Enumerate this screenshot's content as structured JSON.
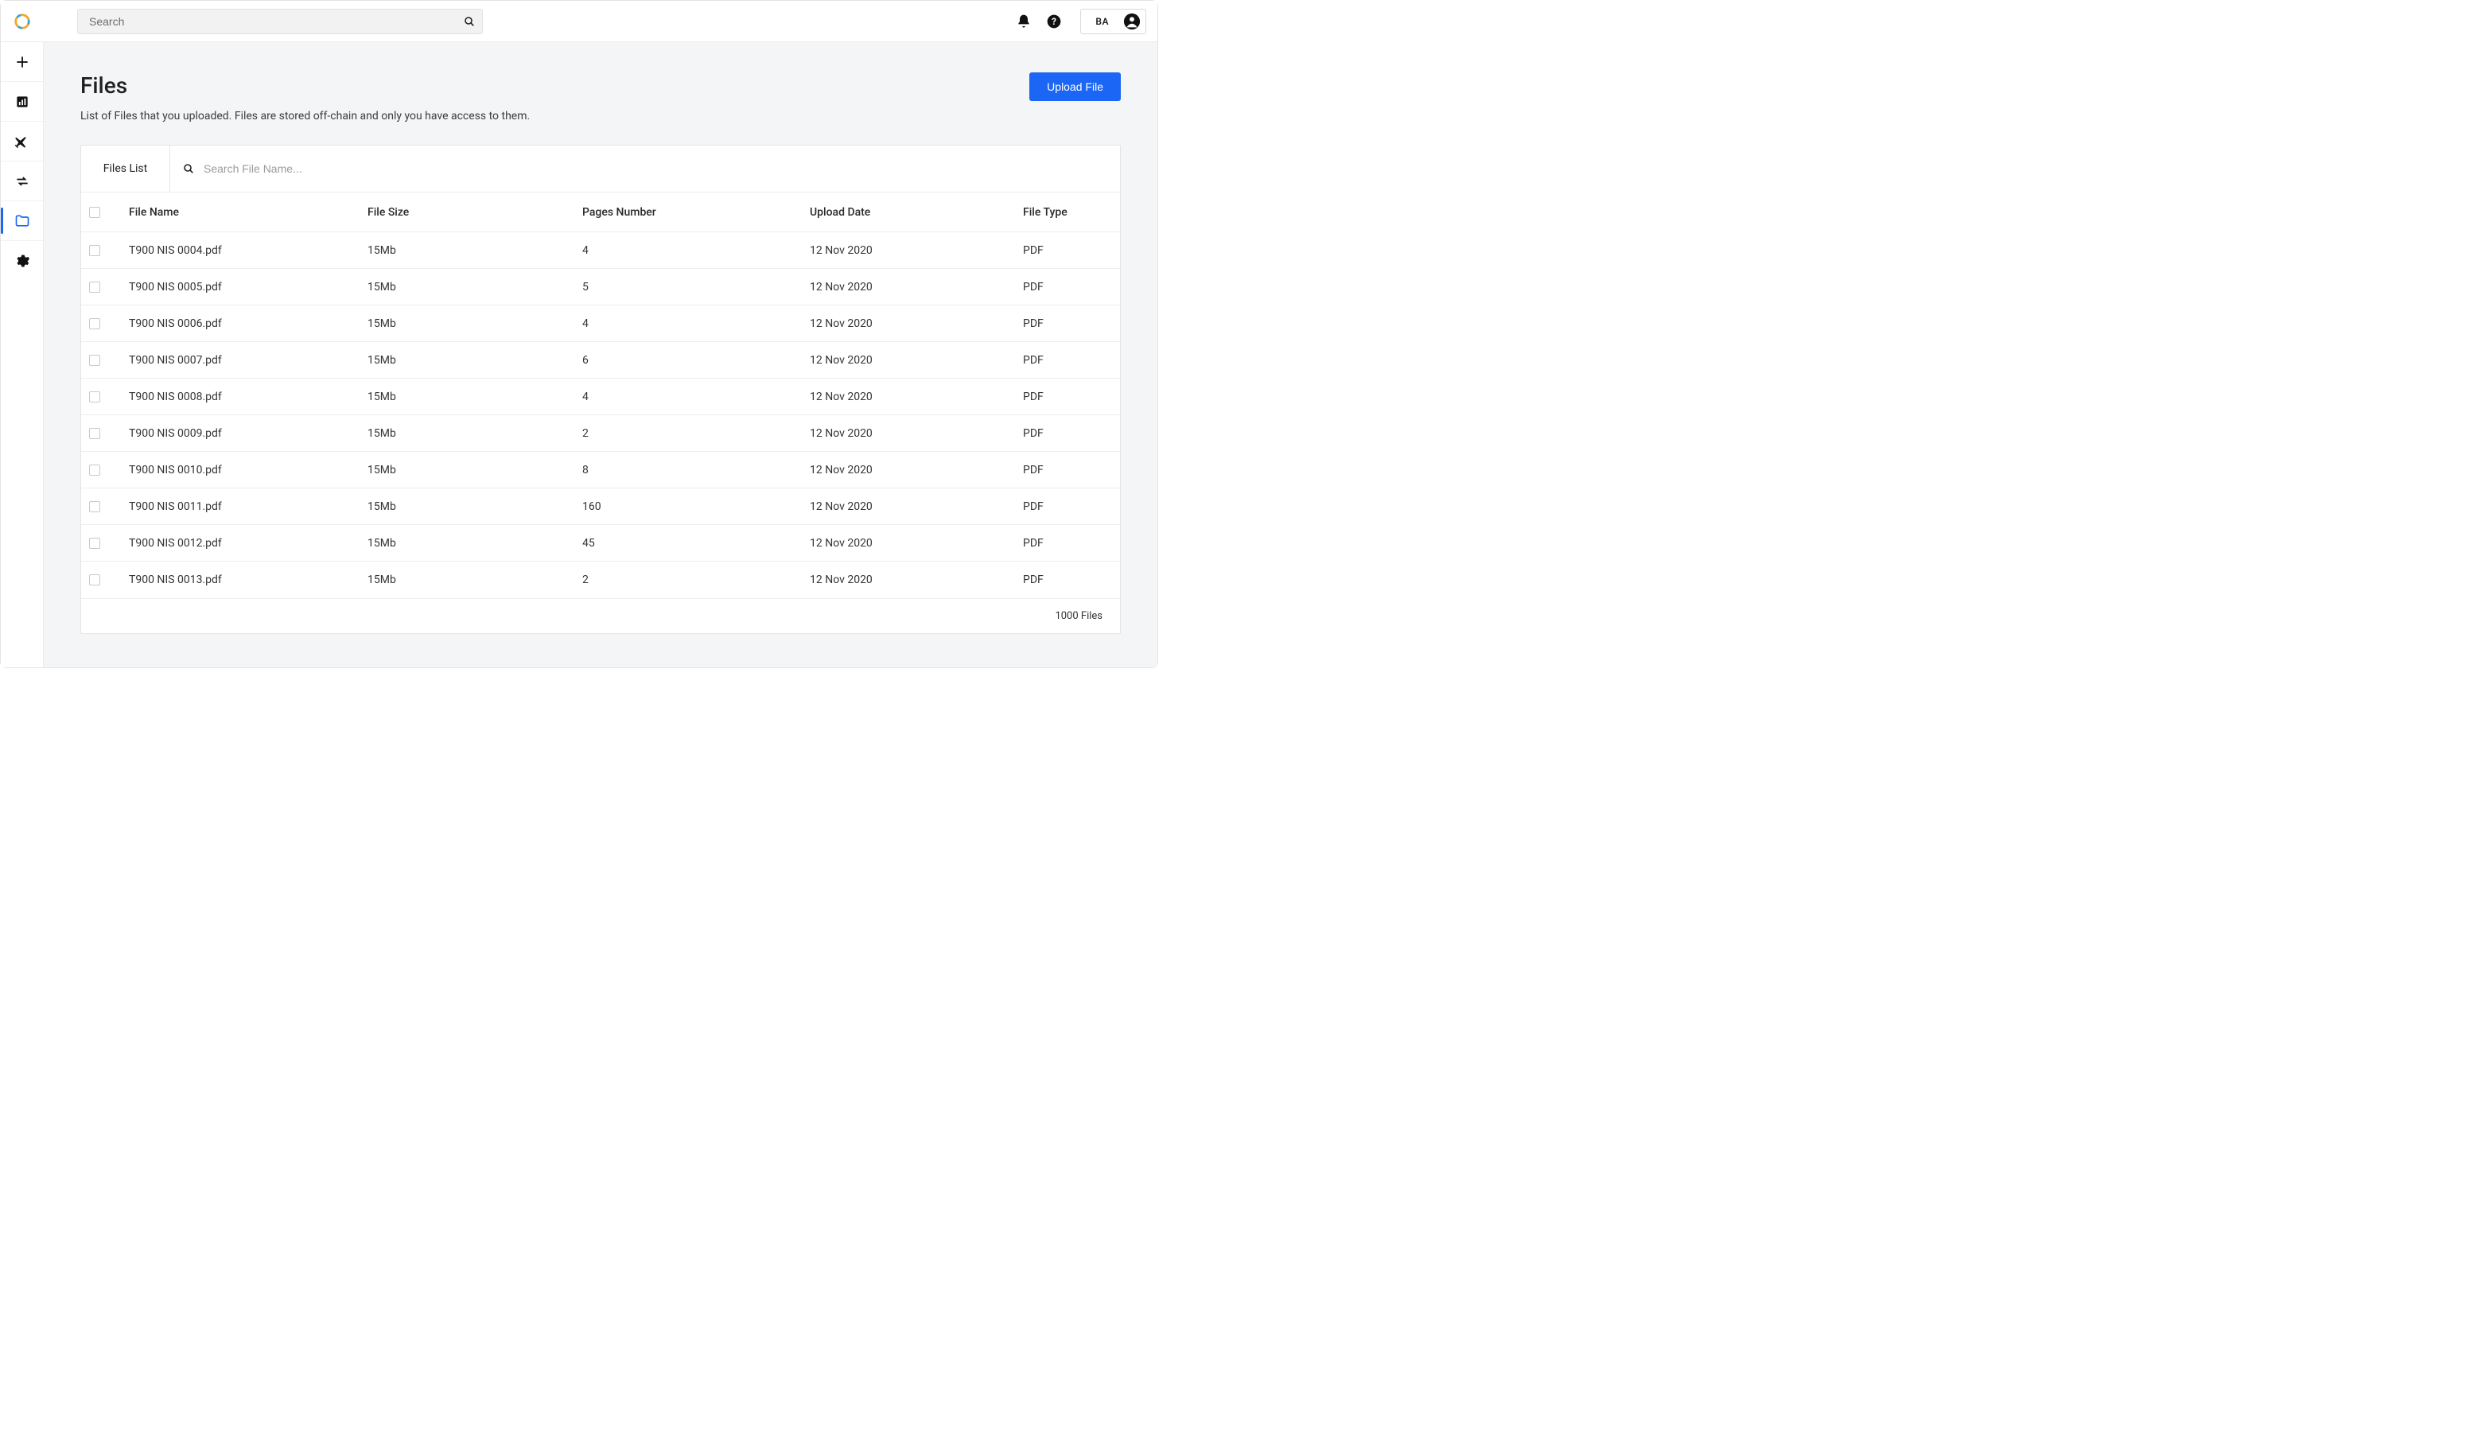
{
  "topbar": {
    "search_placeholder": "Search",
    "account_initials": "BA"
  },
  "page": {
    "title": "Files",
    "description": "List of Files that you uploaded. Files are stored off-chain and only you have access to them.",
    "upload_button": "Upload File"
  },
  "table": {
    "tab_label": "Files List",
    "search_placeholder": "Search File Name...",
    "columns": {
      "name": "File Name",
      "size": "File Size",
      "pages": "Pages Number",
      "date": "Upload Date",
      "type": "File Type"
    },
    "rows": [
      {
        "name": "T900 NIS 0004.pdf",
        "size": "15Mb",
        "pages": "4",
        "date": "12 Nov 2020",
        "type": "PDF"
      },
      {
        "name": "T900 NIS 0005.pdf",
        "size": "15Mb",
        "pages": "5",
        "date": "12 Nov 2020",
        "type": "PDF"
      },
      {
        "name": "T900 NIS 0006.pdf",
        "size": "15Mb",
        "pages": "4",
        "date": "12 Nov 2020",
        "type": "PDF"
      },
      {
        "name": "T900 NIS 0007.pdf",
        "size": "15Mb",
        "pages": "6",
        "date": "12 Nov 2020",
        "type": "PDF"
      },
      {
        "name": "T900 NIS 0008.pdf",
        "size": "15Mb",
        "pages": "4",
        "date": "12 Nov 2020",
        "type": "PDF"
      },
      {
        "name": "T900 NIS 0009.pdf",
        "size": "15Mb",
        "pages": "2",
        "date": "12 Nov 2020",
        "type": "PDF"
      },
      {
        "name": "T900 NIS 0010.pdf",
        "size": "15Mb",
        "pages": "8",
        "date": "12 Nov 2020",
        "type": "PDF"
      },
      {
        "name": "T900 NIS 0011.pdf",
        "size": "15Mb",
        "pages": "160",
        "date": "12 Nov 2020",
        "type": "PDF"
      },
      {
        "name": "T900 NIS 0012.pdf",
        "size": "15Mb",
        "pages": "45",
        "date": "12 Nov 2020",
        "type": "PDF"
      },
      {
        "name": "T900 NIS 0013.pdf",
        "size": "15Mb",
        "pages": "2",
        "date": "12 Nov 2020",
        "type": "PDF"
      }
    ],
    "footer": "1000 Files"
  }
}
